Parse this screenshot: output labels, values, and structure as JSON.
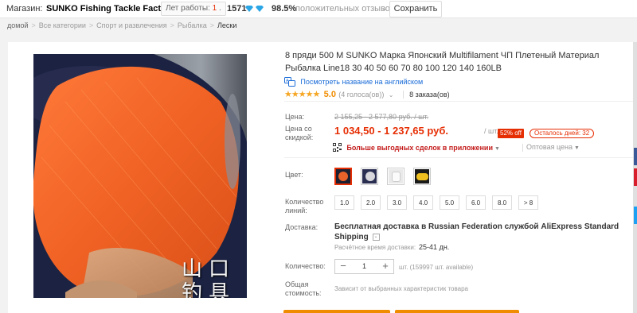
{
  "store": {
    "label": "Магазин:",
    "name": "SUNKO Fishing Tackle Factory",
    "years_label": "Лет работы:",
    "years_value": "1",
    "rating": "1571",
    "positive_percent": "98.5%",
    "positive_label": "положительных отзывов",
    "save_label": "Сохранить"
  },
  "breadcrumb": [
    "домой",
    "Все категории",
    "Спорт и развлечения",
    "Рыбалка",
    "Лески"
  ],
  "product": {
    "title": "8 пряди 500 M SUNKO Марка Японский Multifilament ЧП Плетеный Материал Рыбалка Line18 30 40 50 60 70 80 100 120 140 160LB",
    "translate_link": "Посмотреть название на английском",
    "rating_value": "5.0",
    "rating_votes": "(4 голоса(ов))",
    "orders": "8 заказа(ов)",
    "image_watermark_top": "山口",
    "image_watermark_bottom": "钓具"
  },
  "price": {
    "label": "Цена:",
    "old": "2 155,25 - 2 577,80 руб.",
    "old_unit": "/ шт.",
    "sale_label": "Цена со скидкой:",
    "sale": "1 034,50 - 1 237,65 руб.",
    "unit": "/ шт.",
    "discount": "52% off",
    "days_left": "Осталось дней: 32",
    "app_deals": "Больше выгодных сделок в приложении",
    "wholesale": "Оптовая цена"
  },
  "options": {
    "color_label": "Цвет:",
    "colors": [
      {
        "name": "orange",
        "hex": "#e8622a"
      },
      {
        "name": "white-spool",
        "hex": "#d8d8dc"
      },
      {
        "name": "white",
        "hex": "#f4f4f4"
      },
      {
        "name": "yellow",
        "hex": "#f0c020"
      }
    ],
    "length_label": "Количество линий:",
    "lengths": [
      "1.0",
      "2.0",
      "3.0",
      "4.0",
      "5.0",
      "6.0",
      "8.0",
      "> 8"
    ]
  },
  "shipping": {
    "label": "Доставка:",
    "text": "Бесплатная доставка в Russian Federation службой AliExpress Standard Shipping",
    "time_label": "Расчётное время доставки:",
    "time_value": "25-41 дн."
  },
  "quantity": {
    "label": "Количество:",
    "value": "1",
    "available": "шт. (159997 шт. available)"
  },
  "total": {
    "label": "Общая стоимость:",
    "value": "Зависит от выбранных характеристик товара"
  },
  "colors": {
    "accent": "#e62e04",
    "link": "#1a6cd8",
    "star": "#f5a623"
  }
}
